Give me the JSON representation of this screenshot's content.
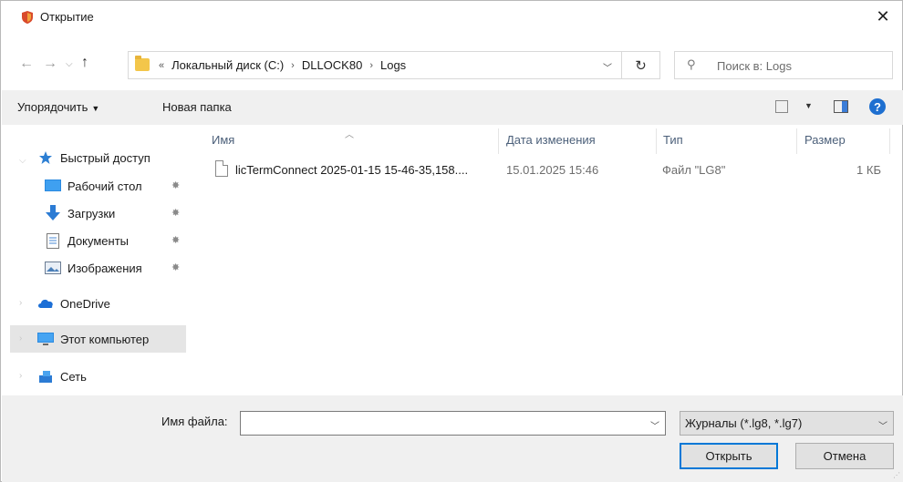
{
  "window": {
    "title": "Открытие",
    "close_icon": "close-icon"
  },
  "address": {
    "overflow": "«",
    "crumbs": [
      "Локальный диск (C:)",
      "DLLOCK80",
      "Logs"
    ],
    "separator": "›"
  },
  "search": {
    "placeholder": "Поиск в: Logs"
  },
  "toolbar": {
    "organize": "Упорядочить",
    "new_folder": "Новая папка",
    "help": "?"
  },
  "sidebar": {
    "items": [
      {
        "label": "Быстрый доступ",
        "icon": "star-icon"
      },
      {
        "label": "Рабочий стол",
        "icon": "desktop-icon"
      },
      {
        "label": "Загрузки",
        "icon": "download-icon"
      },
      {
        "label": "Документы",
        "icon": "documents-icon"
      },
      {
        "label": "Изображения",
        "icon": "pictures-icon"
      },
      {
        "label": "OneDrive",
        "icon": "cloud-icon"
      },
      {
        "label": "Этот компьютер",
        "icon": "computer-icon"
      },
      {
        "label": "Сеть",
        "icon": "network-icon"
      }
    ]
  },
  "columns": {
    "name": "Имя",
    "date": "Дата изменения",
    "type": "Тип",
    "size": "Размер"
  },
  "files": [
    {
      "name": "licTermConnect 2025-01-15 15-46-35,158....",
      "date": "15.01.2025 15:46",
      "type": "Файл \"LG8\"",
      "size": "1 КБ"
    }
  ],
  "bottom": {
    "filename_label": "Имя файла:",
    "filename_value": "",
    "filter": "Журналы (*.lg8, *.lg7)",
    "open": "Открыть",
    "cancel": "Отмена"
  },
  "colors": {
    "accent": "#0078d7",
    "selected": "#e5e5e5",
    "toolbar_bg": "#f0f0f0"
  }
}
